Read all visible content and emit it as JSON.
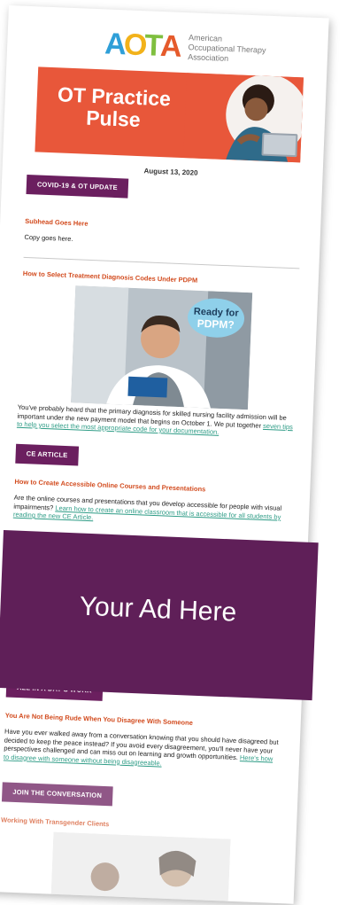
{
  "logo": {
    "letters": [
      "A",
      "O",
      "T",
      "A"
    ],
    "letter_colors": [
      "#2f9fd8",
      "#f2b21a",
      "#7fbf3f",
      "#e55a2b"
    ],
    "org_line1": "American",
    "org_line2": "Occupational Therapy",
    "org_line3": "Association"
  },
  "banner": {
    "title_line1": "OT Practice",
    "title_line2": "Pulse",
    "color": "#e8573a"
  },
  "date": "August 13, 2020",
  "sections": {
    "covid": {
      "tag": "COVID-19 & OT UPDATE",
      "subhead": "Subhead Goes Here",
      "copy": "Copy goes here."
    },
    "pdpm": {
      "subhead": "How to Select Treatment Diagnosis Codes Under PDPM",
      "bubble_line1": "Ready for",
      "bubble_line2": "PDPM?",
      "copy": "You've probably heard that the primary diagnosis for skilled nursing facility admission will be important under the new payment model that begins on October 1. We put together ",
      "link": "seven tips to help you select the most appropriate code for your documentation.",
      "tag": "CE ARTICLE"
    },
    "accessible": {
      "subhead": "How to Create Accessible Online Courses and Presentations",
      "copy": "Are the online courses and presentations that you develop accessible for people with visual impairments? ",
      "link": "Learn how to create an online classroom that is accessible for all students by reading the new CE Article."
    },
    "ad": {
      "text": "Your Ad Here",
      "color": "#5f1f58"
    },
    "work": {
      "tag": "ALL IN A DAY'S WORK",
      "subhead": "You Are Not Being Rude When You Disagree With Someone",
      "copy": "Have you ever walked away from a conversation knowing that you should have disagreed but decided to keep the peace instead? If you avoid every disagreement, you'll never have your perspectives challenged and can miss out on learning and growth opportunities. ",
      "link": "Here's how to disagree with someone without being disagreeable."
    },
    "join": {
      "tag": "JOIN THE CONVERSATION",
      "subhead": "Working With Transgender Clients"
    }
  },
  "colors": {
    "purple": "#6b1f5f",
    "orange_head": "#d24b1e",
    "link": "#2e9c86"
  }
}
